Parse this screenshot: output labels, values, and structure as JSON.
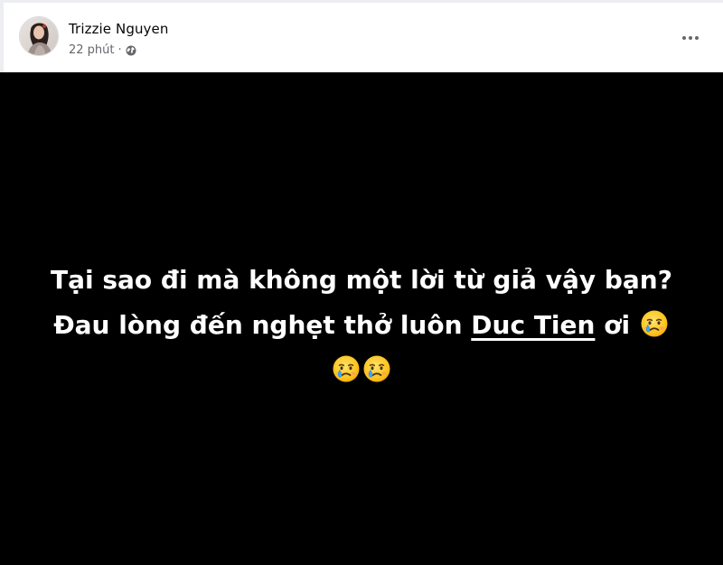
{
  "post": {
    "author": {
      "name": "Trizzie Nguyen",
      "avatar_icon": "profile-photo"
    },
    "timestamp": "22 phút",
    "separator": "·",
    "privacy_icon": "globe-icon",
    "more_icon": "more-options-icon",
    "status": {
      "background_color": "#000000",
      "text_color": "#ffffff",
      "line1": "Tại sao đi mà không một lời từ giả vậy bạn?",
      "line2_prefix": "Đau lòng đến nghẹt thở luôn ",
      "mention": "Duc Tien",
      "line2_suffix": " ơi",
      "emoji": "crying-face-emoji",
      "line2_emoji_count": 1,
      "line3_emoji_count": 2
    }
  }
}
